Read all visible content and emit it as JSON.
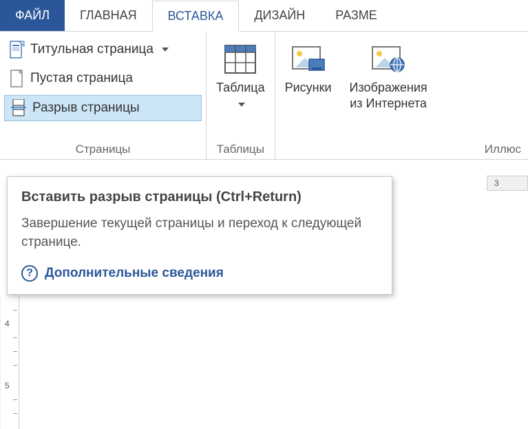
{
  "tabs": {
    "file": "ФАЙЛ",
    "home": "ГЛАВНАЯ",
    "insert": "ВСТАВКА",
    "design": "ДИЗАЙН",
    "layout": "РАЗМЕ"
  },
  "groups": {
    "pages": {
      "label": "Страницы",
      "cover_page": "Титульная страница",
      "blank_page": "Пустая страница",
      "page_break": "Разрыв страницы"
    },
    "tables": {
      "label": "Таблицы",
      "table": "Таблица"
    },
    "illustrations": {
      "label": "Иллюс",
      "pictures": "Рисунки",
      "online_pictures_l1": "Изображения",
      "online_pictures_l2": "из Интернета"
    }
  },
  "tooltip": {
    "title": "Вставить разрыв страницы (Ctrl+Return)",
    "description": "Завершение текущей страницы и переход к следующей странице.",
    "more_info": "Дополнительные сведения"
  },
  "ruler": {
    "h_mark": "3",
    "v_marks": [
      "4",
      "5"
    ]
  }
}
